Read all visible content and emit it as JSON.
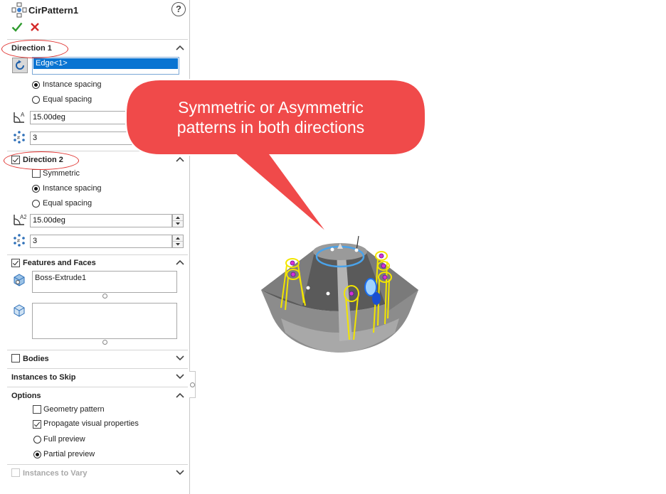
{
  "header": {
    "title": "CirPattern1",
    "help": "?"
  },
  "direction1": {
    "title": "Direction 1",
    "selection": "Edge<1>",
    "options": [
      "Instance spacing",
      "Equal spacing"
    ],
    "selected": "Instance spacing",
    "angle": "15.00deg",
    "count": "3"
  },
  "direction2": {
    "title": "Direction 2",
    "checked": true,
    "symmetric_label": "Symmetric",
    "options": [
      "Instance spacing",
      "Equal spacing"
    ],
    "selected": "Instance spacing",
    "angle": "15.00deg",
    "count": "3"
  },
  "features": {
    "title": "Features and Faces",
    "checked": true,
    "items": [
      "Boss-Extrude1"
    ]
  },
  "bodies": {
    "title": "Bodies",
    "checked": false
  },
  "skip": {
    "title": "Instances to Skip"
  },
  "options": {
    "title": "Options",
    "geometry_pattern": "Geometry pattern",
    "propagate": "Propagate visual properties",
    "full_preview": "Full preview",
    "partial_preview": "Partial preview"
  },
  "vary": {
    "title": "Instances to Vary"
  },
  "callout": {
    "line1": "Symmetric or Asymmetric",
    "line2": "patterns in both directions",
    "color": "#f04a4a"
  },
  "colors": {
    "accent": "#0a74d2",
    "ok": "#2e9b2e",
    "cancel": "#d42a2a",
    "highlight_ring": "#e0322f",
    "preview": "#f2e500"
  }
}
